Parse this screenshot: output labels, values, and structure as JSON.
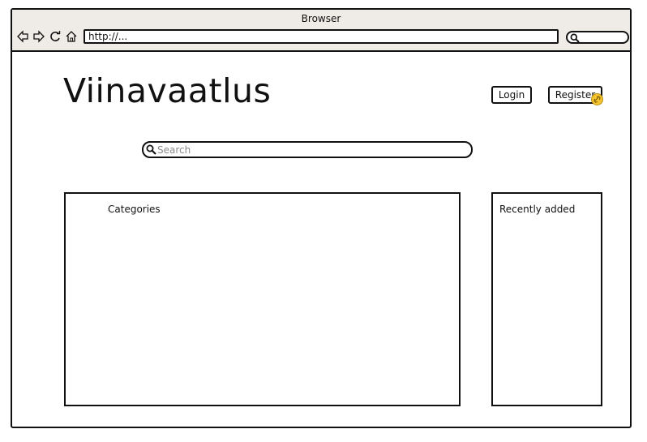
{
  "browser": {
    "title": "Browser",
    "address": "http://...",
    "nav_icons": [
      "back-arrow-icon",
      "forward-arrow-icon",
      "reload-icon",
      "home-icon"
    ],
    "search_icon": "search-icon"
  },
  "header": {
    "site_title": "Viinavaatlus",
    "login_label": "Login",
    "register_label": "Register",
    "link_badge_icon": "link-icon",
    "badge_color": "#f4c430"
  },
  "search": {
    "placeholder": "Search",
    "value": ""
  },
  "panels": {
    "categories_title": "Categories",
    "recent_title": "Recently added"
  }
}
